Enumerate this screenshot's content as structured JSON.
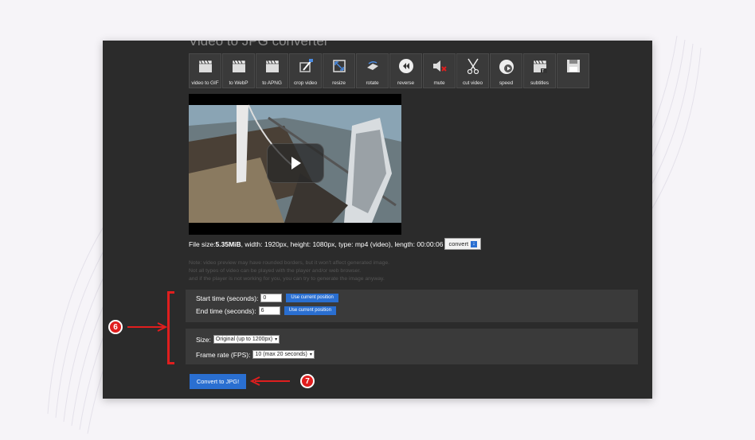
{
  "page": {
    "title": "Video to JPG converter"
  },
  "toolbar": {
    "items": [
      {
        "label": "video to GIF",
        "icon": "clapperboard-icon"
      },
      {
        "label": "to WebP",
        "icon": "clapperboard-icon"
      },
      {
        "label": "to APNG",
        "icon": "clapperboard-icon"
      },
      {
        "label": "crop video",
        "icon": "crop-icon"
      },
      {
        "label": "resize",
        "icon": "resize-icon"
      },
      {
        "label": "rotate",
        "icon": "rotate-icon"
      },
      {
        "label": "reverse",
        "icon": "reverse-icon"
      },
      {
        "label": "mute",
        "icon": "mute-icon"
      },
      {
        "label": "cut video",
        "icon": "scissors-icon"
      },
      {
        "label": "speed",
        "icon": "speed-icon"
      },
      {
        "label": "subtitles",
        "icon": "subtitles-icon"
      },
      {
        "label": "",
        "icon": "save-icon"
      }
    ]
  },
  "video": {
    "play_icon": "play-icon"
  },
  "file_info": {
    "prefix": "File size: ",
    "size": "5.35MiB",
    "details": ", width: 1920px, height: 1080px, type: mp4 (video), length: 00:00:06",
    "convert_label": "convert"
  },
  "notes": {
    "line1": "Note: video preview may have rounded borders, but it won't affect generated image.",
    "line2": "Not all types of video can be played with the player and/or web browser.",
    "line3": "and if the player is not working for you, you can try to generate the image anyway."
  },
  "timing": {
    "start_label": "Start time (seconds):",
    "start_value": "0",
    "end_label": "End time (seconds):",
    "end_value": "6",
    "use_position_label": "Use current position"
  },
  "options": {
    "size_label": "Size:",
    "size_value": "Original (up to 1200px)",
    "fps_label": "Frame rate (FPS):",
    "fps_value": "10 (max 20 seconds)"
  },
  "actions": {
    "convert_label": "Convert to JPG!"
  },
  "annotations": {
    "badge_6": "6",
    "badge_7": "7",
    "accent_color": "#e01e1e"
  },
  "colors": {
    "panel_bg": "#2b2b2b",
    "button_blue": "#2a6fd1"
  }
}
